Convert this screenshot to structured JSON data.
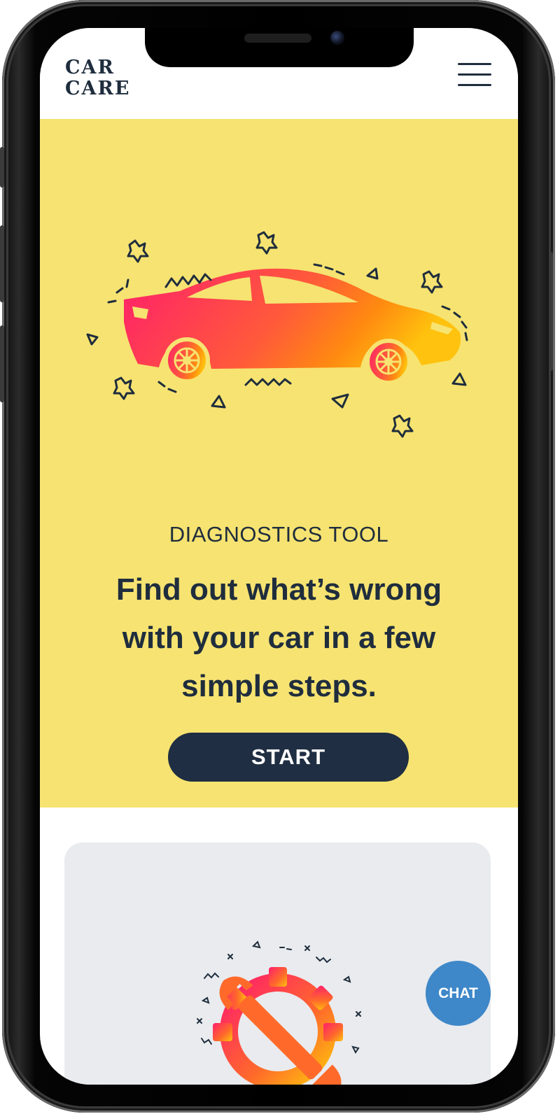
{
  "header": {
    "logo_line1": "CAR",
    "logo_line2": "CARE"
  },
  "hero": {
    "eyebrow": "DIAGNOSTICS TOOL",
    "headline": "Find out what’s wrong with your car in a few simple steps.",
    "start_label": "START"
  },
  "chat": {
    "label": "CHAT"
  },
  "icons": {
    "menu": "hamburger-menu-icon",
    "hero": "car-illustration",
    "card": "gear-wrench-illustration"
  },
  "colors": {
    "hero_bg": "#f6e371",
    "navy": "#1f2d3d",
    "chat_blue": "#3e87c8",
    "card_bg": "#e9ebee",
    "gradient_start": "#ff1f6b",
    "gradient_end": "#ffc20e"
  }
}
